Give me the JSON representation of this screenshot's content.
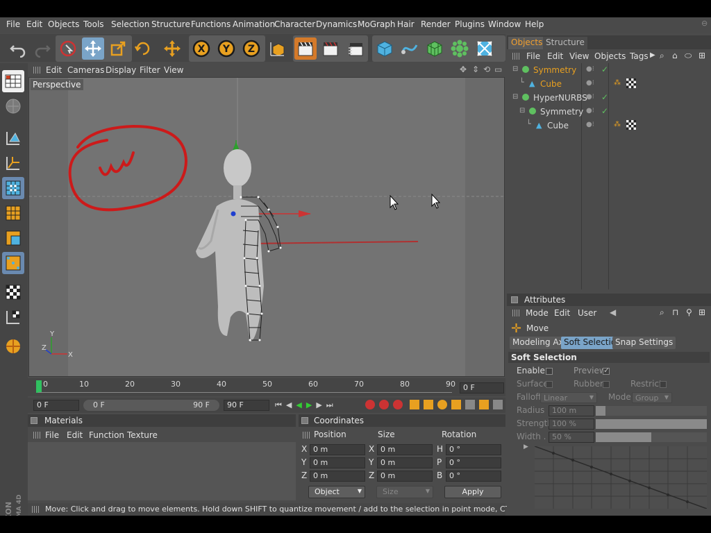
{
  "menu": [
    "File",
    "Edit",
    "Objects",
    "Tools",
    "Selection",
    "Structure",
    "Functions",
    "Animation",
    "Character",
    "Dynamics",
    "MoGraph",
    "Hair",
    "Render",
    "Plugins",
    "Window",
    "Help"
  ],
  "toolbar": {
    "icons": [
      "undo-icon",
      "redo-icon",
      "live-select-icon",
      "move-icon",
      "scale-icon",
      "rotate-icon",
      "move-tool-icon",
      "x-axis-icon",
      "y-axis-icon",
      "z-axis-icon",
      "world-coords-icon",
      "render-view-icon",
      "render-picture-viewer-icon",
      "render-settings-icon",
      "cube-primitive-icon",
      "spline-icon",
      "nurbs-icon",
      "array-icon",
      "deformer-icon"
    ],
    "axis_labels": [
      "X",
      "Y",
      "Z"
    ]
  },
  "viewport": {
    "menu": [
      "Edit",
      "Cameras",
      "Display",
      "Filter",
      "View"
    ],
    "label": "Perspective",
    "axis_labels": {
      "x": "X",
      "y": "Y",
      "z": "Z"
    }
  },
  "timeline": {
    "ticks": [
      "0",
      "10",
      "20",
      "30",
      "40",
      "50",
      "60",
      "70",
      "80",
      "90"
    ],
    "current_frame": "0 F",
    "start_field": "0 F",
    "range_start": "0 F",
    "range_end": "90 F",
    "end_field": "90 F"
  },
  "materials": {
    "title": "Materials",
    "menu": [
      "File",
      "Edit",
      "Function",
      "Texture"
    ]
  },
  "coordinates": {
    "title": "Coordinates",
    "headers": [
      "Position",
      "Size",
      "Rotation"
    ],
    "rows": [
      {
        "axis": "X",
        "pos": "0 m",
        "size_axis": "X",
        "size": "0 m",
        "rot_axis": "H",
        "rot": "0 °"
      },
      {
        "axis": "Y",
        "pos": "0 m",
        "size_axis": "Y",
        "size": "0 m",
        "rot_axis": "P",
        "rot": "0 °"
      },
      {
        "axis": "Z",
        "pos": "0 m",
        "size_axis": "Z",
        "size": "0 m",
        "rot_axis": "B",
        "rot": "0 °"
      }
    ],
    "mode_select": "Object",
    "size_select": "Size",
    "apply_label": "Apply"
  },
  "status": "Move: Click and drag to move elements. Hold down SHIFT to quantize movement / add to the selection in point mode, CTRL to remove.",
  "objects_panel": {
    "tabs": [
      "Objects",
      "Structure"
    ],
    "menu": [
      "File",
      "Edit",
      "View",
      "Objects",
      "Tags"
    ],
    "items": [
      {
        "name": "Symmetry",
        "indent": 0,
        "color": "#e8a020",
        "type": "symmetry"
      },
      {
        "name": "Cube",
        "indent": 1,
        "color": "#e8a020",
        "type": "cube"
      },
      {
        "name": "HyperNURBS",
        "indent": 0,
        "color": "#d8d8d8",
        "type": "nurbs"
      },
      {
        "name": "Symmetry",
        "indent": 1,
        "color": "#d8d8d8",
        "type": "symmetry"
      },
      {
        "name": "Cube",
        "indent": 2,
        "color": "#d8d8d8",
        "type": "cube"
      }
    ]
  },
  "attributes": {
    "title": "Attributes",
    "menu": [
      "Mode",
      "Edit",
      "User"
    ],
    "tool_name": "Move",
    "tabs": [
      "Modeling Axis",
      "Soft Selection",
      "Snap Settings"
    ],
    "active_tab": "Soft Selection",
    "section": "Soft Selection",
    "enable_label": "Enable",
    "preview_label": "Preview",
    "surface_label": "Surface",
    "rubber_label": "Rubber",
    "restrict_label": "Restrict",
    "falloff_label": "Falloff",
    "falloff_value": "Linear",
    "mode_label": "Mode",
    "mode_value": "Group",
    "radius_label": "Radius",
    "radius_value": "100 m",
    "strength_label": "Strength",
    "strength_value": "100 %",
    "strength_fraction": 1.0,
    "width_label": "Width . .",
    "width_value": "50 %",
    "width_fraction": 0.5
  },
  "brand": {
    "line1": "MAXON",
    "line2": "CINEMA 4D"
  }
}
